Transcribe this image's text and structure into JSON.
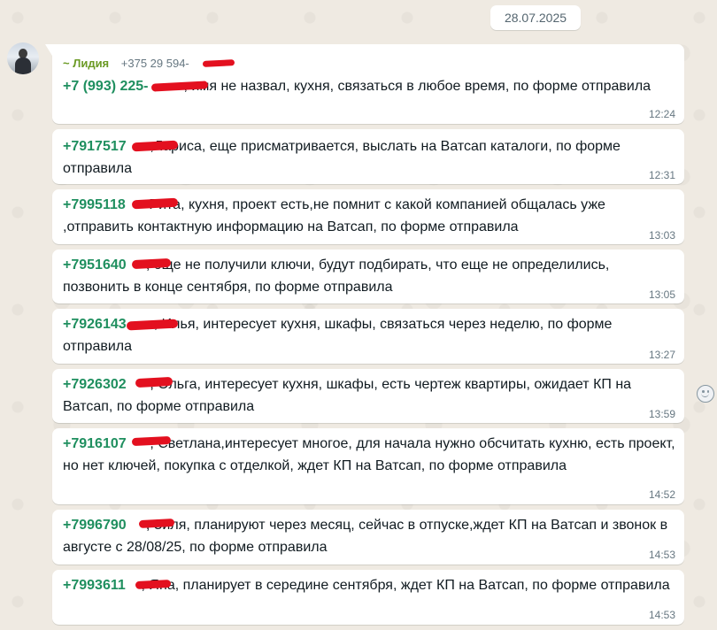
{
  "chat": {
    "date": "28.07.2025",
    "sender": {
      "name": "~ Лидия",
      "phone": "+375 29 594-"
    },
    "messages": [
      {
        "phone": "+7 (993) 225-",
        "text": ", имя не назвал, кухня, связаться в любое время, по форме отправила",
        "time": "12:24"
      },
      {
        "phone": "+7917517",
        "text": ",Лариса, еще присматривается, выслать на Ватсап каталоги, по форме отправила",
        "time": "12:31"
      },
      {
        "phone": "+7995118",
        "text": "Рита, кухня, проект есть,не помнит с какой компанией общалась уже ,отправить контактную информацию на Ватсап, по форме отправила",
        "time": "13:03"
      },
      {
        "phone": "+7951640",
        "text": ", еще не получили ключи, будут подбирать, что еще не определились, позвонить в конце сентября, по форме отправила",
        "time": "13:05"
      },
      {
        "phone": "+7926143",
        "text": ", Илья, интересует кухня, шкафы, связаться через неделю, по форме отправила",
        "time": "13:27"
      },
      {
        "phone": "+7926302",
        "text": ", Ольга, интересует кухня, шкафы, есть чертеж квартиры, ожидает КП на Ватсап, по форме отправила",
        "time": "13:59"
      },
      {
        "phone": "+7916107",
        "text": ", Светлана,интересует многое, для начала нужно обсчитать кухню, есть проект, но нет ключей, покупка с отделкой, ждет КП на Ватсап, по форме отправила",
        "time": "14:52"
      },
      {
        "phone": "+7996790",
        "text": ", Зиля, планируют через месяц, сейчас в отпуске,ждет КП на Ватсап и звонок в августе с 28/08/25, по форме отправила",
        "time": "14:53"
      },
      {
        "phone": "+7993611",
        "text": ", Яна, планирует в середине сентября, ждет КП на Ватсап, по форме отправила",
        "time": "14:53"
      }
    ]
  },
  "colors": {
    "background": "#efeae2",
    "bubble": "#ffffff",
    "phone_link": "#1f8f5f",
    "sender_name": "#6b9a24",
    "redaction": "#e3101f",
    "timestamp": "#667781"
  },
  "icons": {
    "emoji": "smiley-icon",
    "avatar": "user-avatar"
  }
}
